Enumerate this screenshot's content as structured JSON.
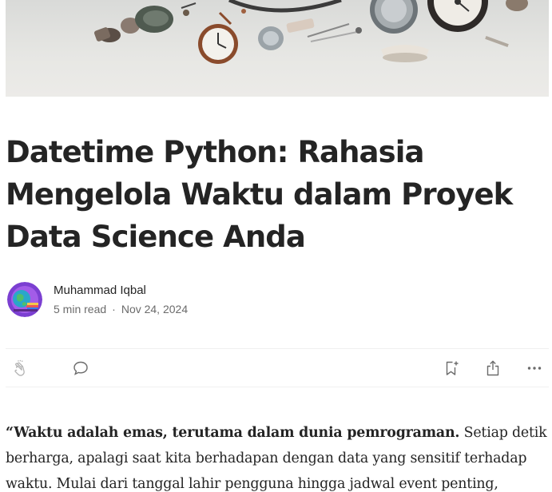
{
  "hero": {
    "image_name": "hero-image-clocks-and-tools"
  },
  "article": {
    "title": "Datetime Python: Rahasia Mengelola Waktu dalam Proyek Data Science Anda",
    "author": {
      "name": "Muhammad Iqbal",
      "avatar_icon": "author-avatar"
    },
    "read_time": "5 min read",
    "separator": "·",
    "date": "Nov 24, 2024",
    "actions": {
      "clap_icon": "clap-icon",
      "comment_icon": "comment-icon",
      "bookmark_icon": "bookmark-add-icon",
      "share_icon": "share-icon",
      "more_icon": "more-icon"
    },
    "body": {
      "lead_bold": "“Waktu adalah emas, terutama dalam dunia pemrograman.",
      "lead_rest": " Setiap detik berharga, apalagi saat kita berhadapan dengan data yang sensitif terhadap waktu. Mulai dari tanggal lahir pengguna hingga jadwal event penting,"
    }
  },
  "colors": {
    "text": "#242424",
    "muted": "#6b6b6b",
    "divider": "#f0f0f0"
  }
}
